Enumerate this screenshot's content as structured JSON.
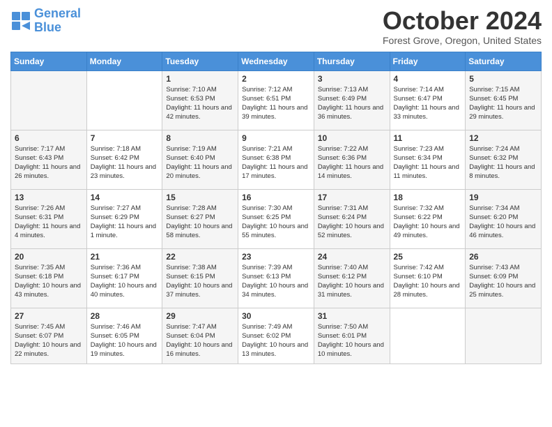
{
  "header": {
    "logo_line1": "General",
    "logo_line2": "Blue",
    "month_title": "October 2024",
    "location": "Forest Grove, Oregon, United States"
  },
  "days_of_week": [
    "Sunday",
    "Monday",
    "Tuesday",
    "Wednesday",
    "Thursday",
    "Friday",
    "Saturday"
  ],
  "weeks": [
    [
      {
        "day": "",
        "info": ""
      },
      {
        "day": "",
        "info": ""
      },
      {
        "day": "1",
        "info": "Sunrise: 7:10 AM\nSunset: 6:53 PM\nDaylight: 11 hours and 42 minutes."
      },
      {
        "day": "2",
        "info": "Sunrise: 7:12 AM\nSunset: 6:51 PM\nDaylight: 11 hours and 39 minutes."
      },
      {
        "day": "3",
        "info": "Sunrise: 7:13 AM\nSunset: 6:49 PM\nDaylight: 11 hours and 36 minutes."
      },
      {
        "day": "4",
        "info": "Sunrise: 7:14 AM\nSunset: 6:47 PM\nDaylight: 11 hours and 33 minutes."
      },
      {
        "day": "5",
        "info": "Sunrise: 7:15 AM\nSunset: 6:45 PM\nDaylight: 11 hours and 29 minutes."
      }
    ],
    [
      {
        "day": "6",
        "info": "Sunrise: 7:17 AM\nSunset: 6:43 PM\nDaylight: 11 hours and 26 minutes."
      },
      {
        "day": "7",
        "info": "Sunrise: 7:18 AM\nSunset: 6:42 PM\nDaylight: 11 hours and 23 minutes."
      },
      {
        "day": "8",
        "info": "Sunrise: 7:19 AM\nSunset: 6:40 PM\nDaylight: 11 hours and 20 minutes."
      },
      {
        "day": "9",
        "info": "Sunrise: 7:21 AM\nSunset: 6:38 PM\nDaylight: 11 hours and 17 minutes."
      },
      {
        "day": "10",
        "info": "Sunrise: 7:22 AM\nSunset: 6:36 PM\nDaylight: 11 hours and 14 minutes."
      },
      {
        "day": "11",
        "info": "Sunrise: 7:23 AM\nSunset: 6:34 PM\nDaylight: 11 hours and 11 minutes."
      },
      {
        "day": "12",
        "info": "Sunrise: 7:24 AM\nSunset: 6:32 PM\nDaylight: 11 hours and 8 minutes."
      }
    ],
    [
      {
        "day": "13",
        "info": "Sunrise: 7:26 AM\nSunset: 6:31 PM\nDaylight: 11 hours and 4 minutes."
      },
      {
        "day": "14",
        "info": "Sunrise: 7:27 AM\nSunset: 6:29 PM\nDaylight: 11 hours and 1 minute."
      },
      {
        "day": "15",
        "info": "Sunrise: 7:28 AM\nSunset: 6:27 PM\nDaylight: 10 hours and 58 minutes."
      },
      {
        "day": "16",
        "info": "Sunrise: 7:30 AM\nSunset: 6:25 PM\nDaylight: 10 hours and 55 minutes."
      },
      {
        "day": "17",
        "info": "Sunrise: 7:31 AM\nSunset: 6:24 PM\nDaylight: 10 hours and 52 minutes."
      },
      {
        "day": "18",
        "info": "Sunrise: 7:32 AM\nSunset: 6:22 PM\nDaylight: 10 hours and 49 minutes."
      },
      {
        "day": "19",
        "info": "Sunrise: 7:34 AM\nSunset: 6:20 PM\nDaylight: 10 hours and 46 minutes."
      }
    ],
    [
      {
        "day": "20",
        "info": "Sunrise: 7:35 AM\nSunset: 6:18 PM\nDaylight: 10 hours and 43 minutes."
      },
      {
        "day": "21",
        "info": "Sunrise: 7:36 AM\nSunset: 6:17 PM\nDaylight: 10 hours and 40 minutes."
      },
      {
        "day": "22",
        "info": "Sunrise: 7:38 AM\nSunset: 6:15 PM\nDaylight: 10 hours and 37 minutes."
      },
      {
        "day": "23",
        "info": "Sunrise: 7:39 AM\nSunset: 6:13 PM\nDaylight: 10 hours and 34 minutes."
      },
      {
        "day": "24",
        "info": "Sunrise: 7:40 AM\nSunset: 6:12 PM\nDaylight: 10 hours and 31 minutes."
      },
      {
        "day": "25",
        "info": "Sunrise: 7:42 AM\nSunset: 6:10 PM\nDaylight: 10 hours and 28 minutes."
      },
      {
        "day": "26",
        "info": "Sunrise: 7:43 AM\nSunset: 6:09 PM\nDaylight: 10 hours and 25 minutes."
      }
    ],
    [
      {
        "day": "27",
        "info": "Sunrise: 7:45 AM\nSunset: 6:07 PM\nDaylight: 10 hours and 22 minutes."
      },
      {
        "day": "28",
        "info": "Sunrise: 7:46 AM\nSunset: 6:05 PM\nDaylight: 10 hours and 19 minutes."
      },
      {
        "day": "29",
        "info": "Sunrise: 7:47 AM\nSunset: 6:04 PM\nDaylight: 10 hours and 16 minutes."
      },
      {
        "day": "30",
        "info": "Sunrise: 7:49 AM\nSunset: 6:02 PM\nDaylight: 10 hours and 13 minutes."
      },
      {
        "day": "31",
        "info": "Sunrise: 7:50 AM\nSunset: 6:01 PM\nDaylight: 10 hours and 10 minutes."
      },
      {
        "day": "",
        "info": ""
      },
      {
        "day": "",
        "info": ""
      }
    ]
  ]
}
